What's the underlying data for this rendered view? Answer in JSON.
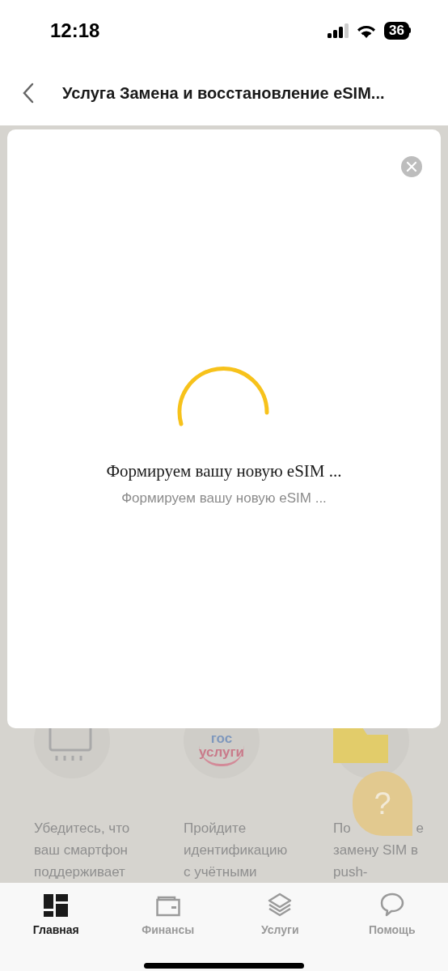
{
  "status_bar": {
    "time": "12:18",
    "battery": "36"
  },
  "header": {
    "title": "Услуга Замена и восстановление eSIM..."
  },
  "modal": {
    "title": "Формируем вашу новую eSIM ...",
    "subtitle": "Формируем вашу новую eSIM ..."
  },
  "steps": [
    {
      "kind": "esim",
      "lines": [
        [
          "Убедитесь, что"
        ],
        [
          "ваш смартфон"
        ],
        [
          "поддерживает"
        ]
      ]
    },
    {
      "kind": "gosuslugi",
      "logo": [
        "гос",
        "услуги"
      ],
      "lines": [
        [
          "Пройдите"
        ],
        [
          "идентификацию"
        ],
        [
          "с учётными"
        ]
      ]
    },
    {
      "kind": "sim",
      "lines": [
        [
          "По",
          "е"
        ],
        [
          "замену SIM в"
        ],
        [
          "push-"
        ]
      ]
    }
  ],
  "help_button": {
    "label": "?"
  },
  "tabs": [
    {
      "kind": "home",
      "label": "Главная",
      "selected": true
    },
    {
      "kind": "wallet",
      "label": "Финансы",
      "selected": false
    },
    {
      "kind": "layers",
      "label": "Услуги",
      "selected": false
    },
    {
      "kind": "chat",
      "label": "Помощь",
      "selected": false
    }
  ]
}
